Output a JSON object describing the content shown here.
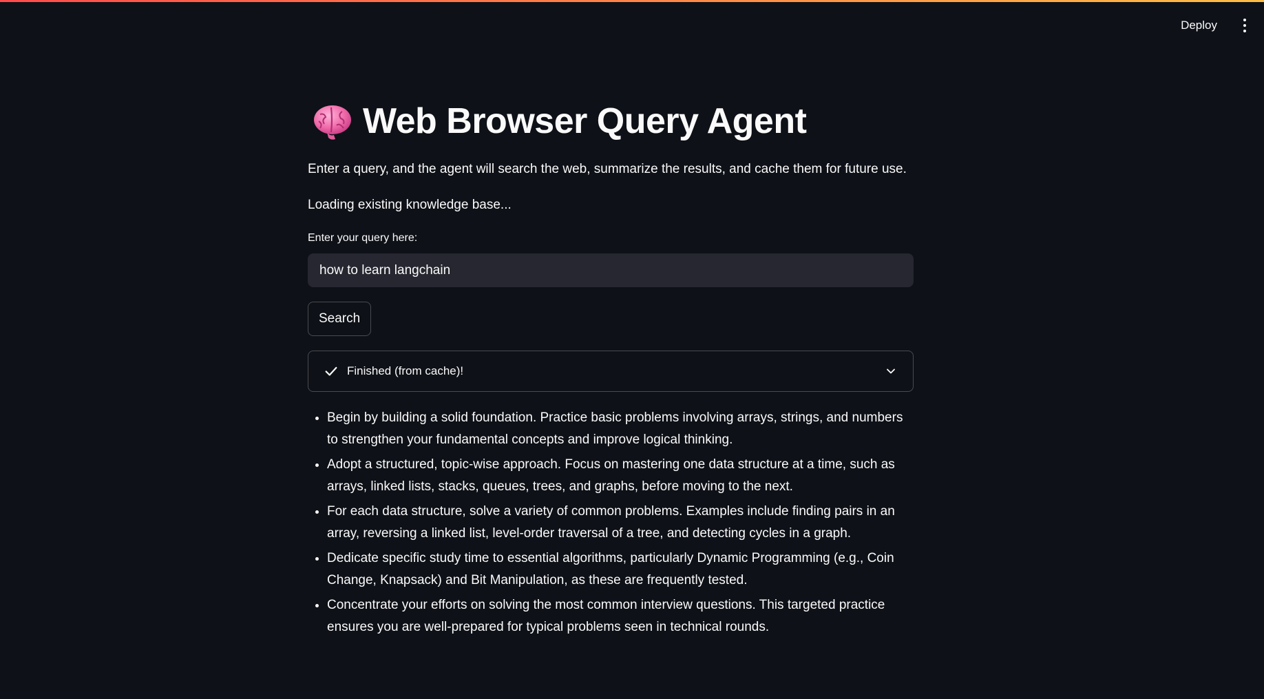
{
  "header": {
    "deploy_label": "Deploy",
    "menu_icon": "more-vertical-icon"
  },
  "main": {
    "title_icon": "brain-emoji-icon",
    "title": "Web Browser Query Agent",
    "description": "Enter a query, and the agent will search the web, summarize the results, and cache them for future use.",
    "loading_text": "Loading existing knowledge base...",
    "query": {
      "label": "Enter your query here:",
      "value": "how to learn langchain"
    },
    "search_label": "Search",
    "status": {
      "text": "Finished (from cache)!",
      "icon": "check-icon",
      "expand_icon": "chevron-down-icon"
    },
    "results": [
      "Begin by building a solid foundation. Practice basic problems involving arrays, strings, and numbers to strengthen your fundamental concepts and improve logical thinking.",
      "Adopt a structured, topic-wise approach. Focus on mastering one data structure at a time, such as arrays, linked lists, stacks, queues, trees, and graphs, before moving to the next.",
      "For each data structure, solve a variety of common problems. Examples include finding pairs in an array, reversing a linked list, level-order traversal of a tree, and detecting cycles in a graph.",
      "Dedicate specific study time to essential algorithms, particularly Dynamic Programming (e.g., Coin Change, Knapsack) and Bit Manipulation, as these are frequently tested.",
      "Concentrate your efforts on solving the most common interview questions. This targeted practice ensures you are well-prepared for typical problems seen in technical rounds."
    ]
  },
  "colors": {
    "background": "#0e1117",
    "input_background": "#262730",
    "text": "#fafafa",
    "top_gradient_start": "#ff4b4b",
    "top_gradient_end": "#ffbd45"
  }
}
